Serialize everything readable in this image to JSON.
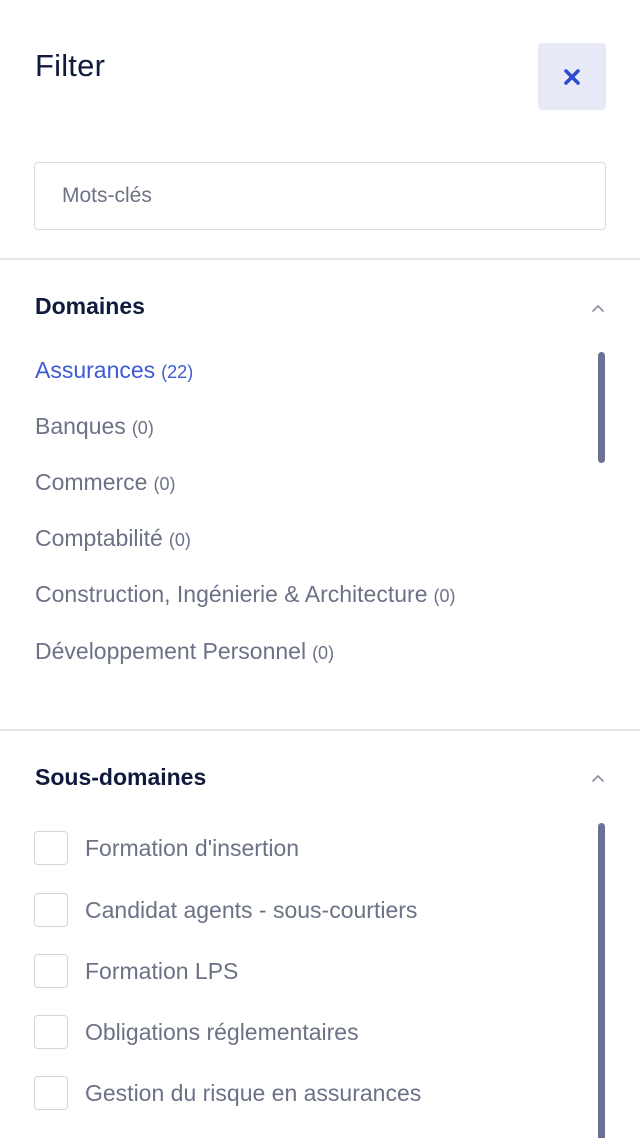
{
  "header": {
    "title": "Filter",
    "close_icon": "close-icon"
  },
  "search": {
    "placeholder": "Mots-clés",
    "value": ""
  },
  "domaines": {
    "title": "Domaines",
    "chevron_icon": "chevron-up-icon",
    "items": [
      {
        "label": "Assurances",
        "count": "(22)",
        "active": true
      },
      {
        "label": "Banques",
        "count": "(0)",
        "active": false
      },
      {
        "label": "Commerce",
        "count": "(0)",
        "active": false
      },
      {
        "label": "Comptabilité",
        "count": "(0)",
        "active": false
      },
      {
        "label": "Construction, Ingénierie & Architecture",
        "count": "(0)",
        "active": false
      },
      {
        "label": "Développement Personnel",
        "count": "(0)",
        "active": false
      }
    ]
  },
  "sous_domaines": {
    "title": "Sous-domaines",
    "chevron_icon": "chevron-up-icon",
    "items": [
      {
        "label": "Formation d'insertion",
        "checked": false
      },
      {
        "label": "Candidat agents - sous-courtiers",
        "checked": false
      },
      {
        "label": "Formation LPS",
        "checked": false
      },
      {
        "label": "Obligations réglementaires",
        "checked": false
      },
      {
        "label": "Gestion du risque en assurances",
        "checked": false
      }
    ]
  },
  "colors": {
    "accent": "#3d5ad6",
    "heading": "#0f1a3c",
    "muted_text": "#6c7286",
    "close_bg": "#e7e9f6",
    "scrollbar": "#6b7190"
  }
}
